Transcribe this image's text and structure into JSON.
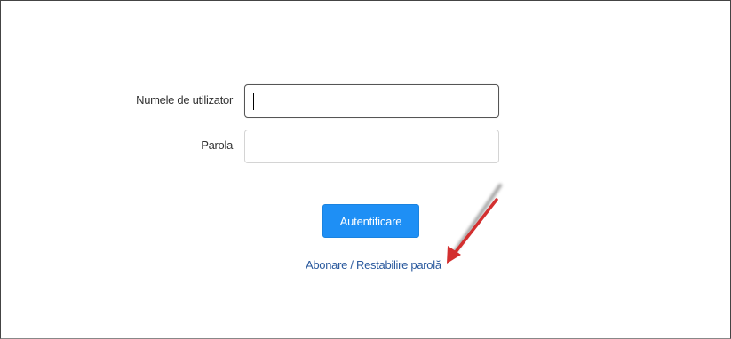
{
  "login_form": {
    "username_label": "Numele de utilizator",
    "username_value": "",
    "password_label": "Parola",
    "password_value": "",
    "submit_label": "Autentificare",
    "register_reset_link": "Abonare / Restabilire parolă"
  },
  "annotation": {
    "arrow_color": "#d32f2f"
  },
  "colors": {
    "button_bg": "#1e8ff5",
    "link": "#2b5a9e"
  }
}
